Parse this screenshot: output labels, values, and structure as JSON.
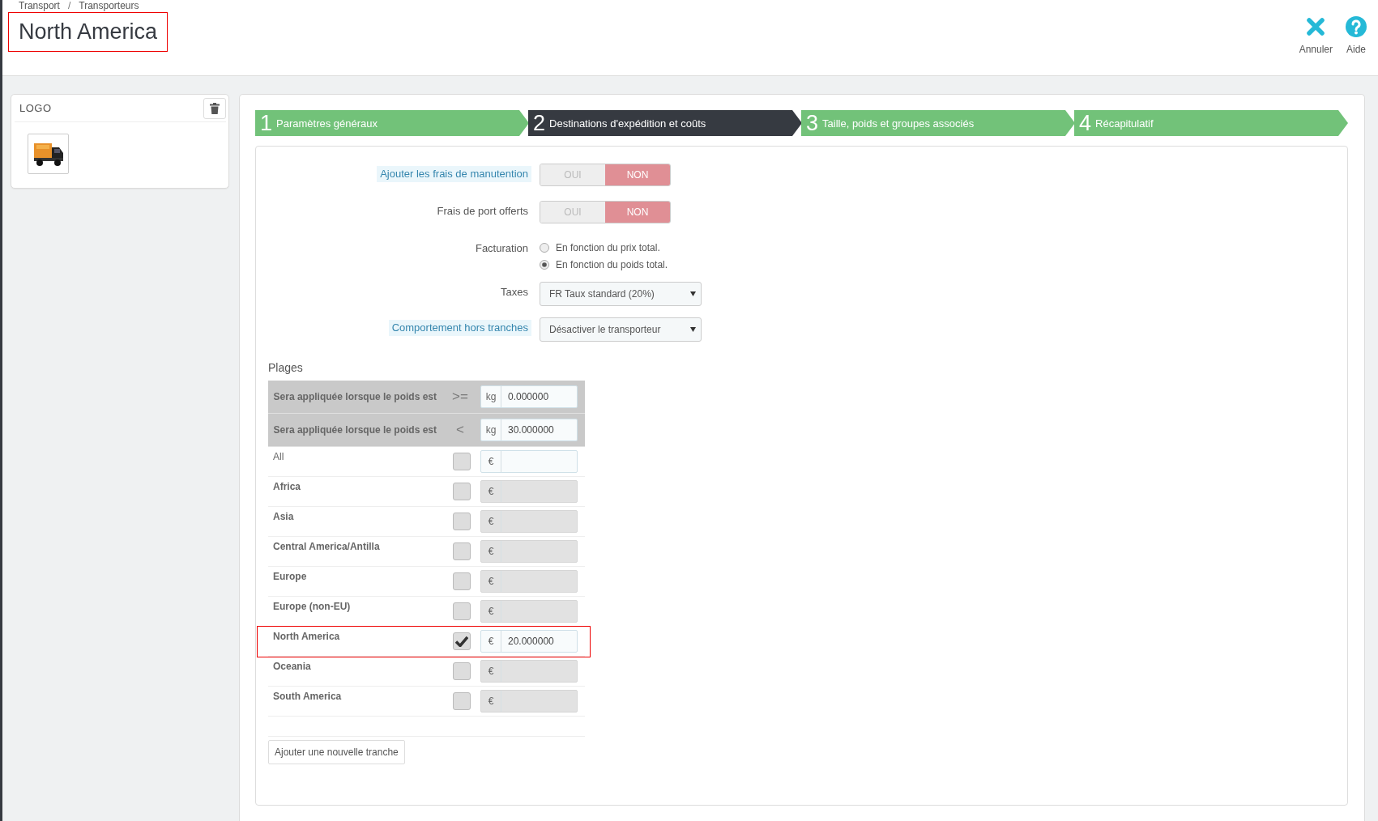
{
  "breadcrumb": [
    "Transport",
    "Transporteurs"
  ],
  "breadcrumb_separator": "/",
  "title": {
    "text": "North America",
    "highlighted": true
  },
  "toolbar": [
    {
      "kind": "cancel",
      "label": "Annuler"
    },
    {
      "kind": "help",
      "label": "Aide"
    }
  ],
  "logo_panel": {
    "title": "LOGO"
  },
  "steps": [
    {
      "number": "1",
      "label": "Paramètres généraux",
      "selected": false
    },
    {
      "number": "2",
      "label": "Destinations d'expédition et coûts",
      "selected": true
    },
    {
      "number": "3",
      "label": "Taille, poids et groupes associés",
      "selected": false
    },
    {
      "number": "4",
      "label": "Récapitulatif",
      "selected": false
    }
  ],
  "toggles": [
    {
      "label": "Ajouter les frais de manutention",
      "hint": true,
      "options": [
        "OUI",
        "NON"
      ],
      "on": false
    },
    {
      "label": "Frais de port offerts",
      "hint": false,
      "options": [
        "OUI",
        "NON"
      ],
      "on": false
    }
  ],
  "billing": {
    "label": "Facturation",
    "options": [
      {
        "label": "En fonction du prix total.",
        "selected": false
      },
      {
        "label": "En fonction du poids total.",
        "selected": true
      }
    ]
  },
  "selects": [
    {
      "label": "Taxes",
      "hint": false,
      "value": "FR Taux standard (20%)"
    },
    {
      "label": "Comportement hors tranches",
      "hint": true,
      "value": "Désactiver le transporteur"
    }
  ],
  "ranges": {
    "title": "Plages",
    "rows": [
      {
        "label": "Sera appliquée lorsque le poids est",
        "operator": ">=",
        "unit": "kg",
        "value": "0.000000"
      },
      {
        "label": "Sera appliquée lorsque le poids est",
        "operator": "<",
        "unit": "kg",
        "value": "30.000000"
      }
    ]
  },
  "zones": [
    {
      "kind": "all",
      "name": "All",
      "checked": false,
      "currency": "€",
      "disabled": false,
      "highlighted": false
    },
    {
      "kind": "zone",
      "name": "Africa",
      "checked": false,
      "currency": "€",
      "disabled": true,
      "highlighted": false
    },
    {
      "kind": "zone",
      "name": "Asia",
      "checked": false,
      "currency": "€",
      "disabled": true,
      "highlighted": false
    },
    {
      "kind": "zone",
      "name": "Central America/Antilla",
      "checked": false,
      "currency": "€",
      "disabled": true,
      "highlighted": false
    },
    {
      "kind": "zone",
      "name": "Europe",
      "checked": false,
      "currency": "€",
      "disabled": true,
      "highlighted": false
    },
    {
      "kind": "zone",
      "name": "Europe (non-EU)",
      "checked": false,
      "currency": "€",
      "disabled": true,
      "highlighted": false
    },
    {
      "kind": "zone",
      "name": "North America",
      "checked": true,
      "currency": "€",
      "value": "20.000000",
      "disabled": false,
      "highlighted": true
    },
    {
      "kind": "zone",
      "name": "Oceania",
      "checked": false,
      "currency": "€",
      "disabled": true,
      "highlighted": false
    },
    {
      "kind": "zone",
      "name": "South America",
      "checked": false,
      "currency": "€",
      "disabled": true,
      "highlighted": false
    }
  ],
  "add_range_button": "Ajouter une nouvelle tranche"
}
